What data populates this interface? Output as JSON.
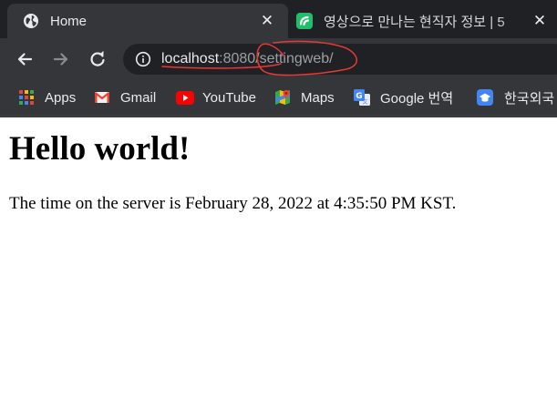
{
  "tabs": [
    {
      "title": "Home",
      "favicon": "globe-icon",
      "active": true
    },
    {
      "title": "영상으로 만나는 현직자 정보 | 5",
      "favicon": "green-brand-icon",
      "active": false
    }
  ],
  "toolbar": {
    "url_host": "localhost",
    "url_rest": ":8080/settingweb/",
    "annotation_color": "#e53935"
  },
  "bookmarks": [
    {
      "label": "Apps",
      "icon": "apps-grid-icon"
    },
    {
      "label": "Gmail",
      "icon": "gmail-icon"
    },
    {
      "label": "YouTube",
      "icon": "youtube-icon"
    },
    {
      "label": "Maps",
      "icon": "maps-icon"
    },
    {
      "label": "Google 번역",
      "icon": "google-translate-icon"
    },
    {
      "label": "한국외국",
      "icon": "hufs-icon"
    }
  ],
  "page": {
    "heading": "Hello world!",
    "server_time_text": "The time on the server is February 28, 2022 at 4:35:50 PM KST."
  },
  "colors": {
    "chrome_dark": "#202124",
    "chrome_mid": "#35363a",
    "text_light": "#e8eaed",
    "url_muted": "#9aa0a6"
  }
}
